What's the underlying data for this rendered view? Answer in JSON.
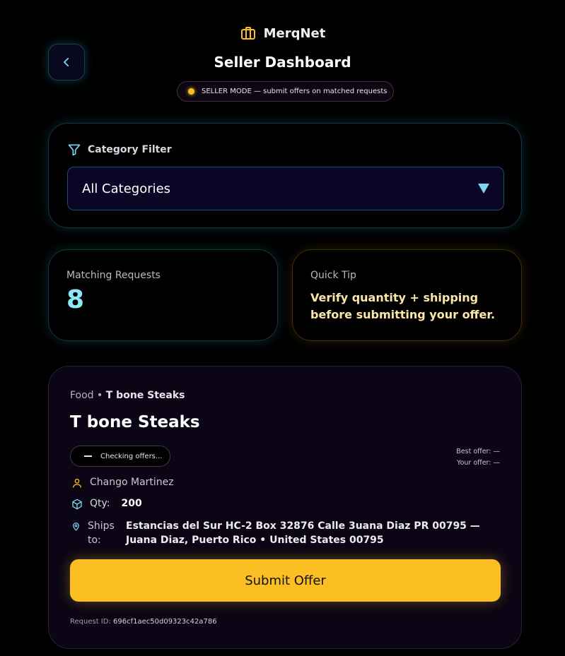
{
  "app": {
    "name": "MerqNet",
    "brand_color": "#fbbf24"
  },
  "header": {
    "title": "Seller Dashboard",
    "mode_text": "SELLER MODE — submit offers on matched requests"
  },
  "filter": {
    "label": "Category Filter",
    "selected": "All Categories"
  },
  "stats": {
    "matching_label": "Matching Requests",
    "matching_count": "8",
    "tip_label": "Quick Tip",
    "tip_text": "Verify quantity + shipping before submitting your offer."
  },
  "request": {
    "category": "Food",
    "separator": "•",
    "item_crumb": "T bone Steaks",
    "title": "T bone Steaks",
    "status": "Checking offers...",
    "best_offer": "Best offer: —",
    "your_offer": "Your offer: —",
    "buyer": "Chango Martinez",
    "qty_label": "Qty:",
    "qty_value": "200",
    "ships_label": "Ships to:",
    "ships_address": "Estancias del Sur HC-2 Box 32876 Calle 3uana Diaz PR 00795 — Juana Diaz, Puerto Rico • United States 00795",
    "submit_label": "Submit Offer",
    "request_id_label": "Request ID:",
    "request_id": "696cf1aec50d09323c42a786"
  },
  "icons": {
    "brand": "briefcase-icon",
    "back": "chevron-left-icon",
    "filter": "funnel-icon",
    "caret": "triangle-down-icon",
    "buyer": "user-icon",
    "qty": "box-icon",
    "ship": "map-pin-icon"
  }
}
